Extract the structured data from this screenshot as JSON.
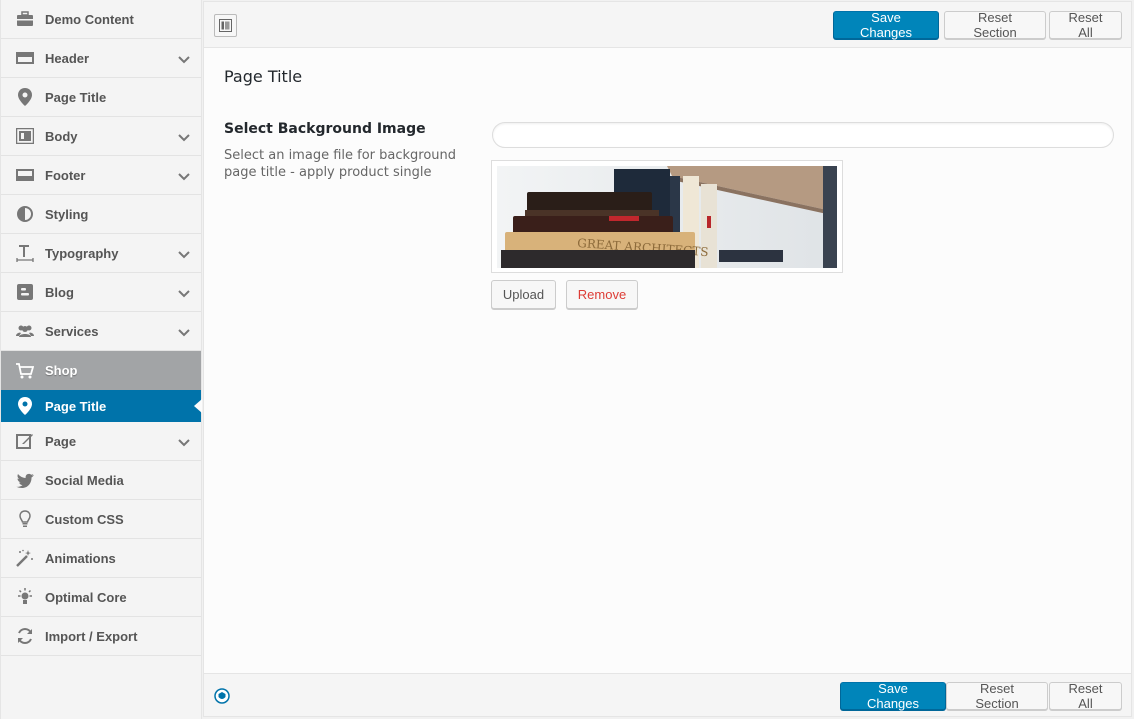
{
  "sidebar": {
    "items": [
      {
        "label": "Demo Content",
        "icon": "briefcase-icon",
        "chevron": false
      },
      {
        "label": "Header",
        "icon": "header-bar-icon",
        "chevron": true
      },
      {
        "label": "Page Title",
        "icon": "location-pin-icon",
        "chevron": false
      },
      {
        "label": "Body",
        "icon": "layout-icon",
        "chevron": true
      },
      {
        "label": "Footer",
        "icon": "footer-bar-icon",
        "chevron": true
      },
      {
        "label": "Styling",
        "icon": "contrast-icon",
        "chevron": false
      },
      {
        "label": "Typography",
        "icon": "text-height-icon",
        "chevron": true
      },
      {
        "label": "Blog",
        "icon": "blogger-icon",
        "chevron": true
      },
      {
        "label": "Services",
        "icon": "users-icon",
        "chevron": true
      },
      {
        "label": "Shop",
        "icon": "cart-icon",
        "chevron": false,
        "state": "parent-active"
      },
      {
        "label": "Page Title",
        "icon": "location-pin-icon",
        "chevron": false,
        "state": "child-active"
      },
      {
        "label": "Page",
        "icon": "edit-icon",
        "chevron": true
      },
      {
        "label": "Social Media",
        "icon": "twitter-icon",
        "chevron": false
      },
      {
        "label": "Custom CSS",
        "icon": "lightbulb-icon",
        "chevron": false
      },
      {
        "label": "Animations",
        "icon": "magic-wand-icon",
        "chevron": false
      },
      {
        "label": "Optimal Core",
        "icon": "bulb-rays-icon",
        "chevron": false
      },
      {
        "label": "Import / Export",
        "icon": "refresh-icon",
        "chevron": false
      }
    ]
  },
  "toolbar": {
    "save_label": "Save Changes",
    "reset_section_label": "Reset Section",
    "reset_all_label": "Reset All"
  },
  "section": {
    "title": "Page Title"
  },
  "field": {
    "title": "Select Background Image",
    "description": "Select an image file for background page title - apply product single",
    "url_value": "",
    "preview_book_text": "GREAT ARCHITECTS",
    "upload_label": "Upload",
    "remove_label": "Remove"
  },
  "colors": {
    "accent": "#0073aa",
    "primary_button": "#0085ba",
    "parent_active": "#a2a4a6",
    "remove_text": "#dd3d36"
  }
}
